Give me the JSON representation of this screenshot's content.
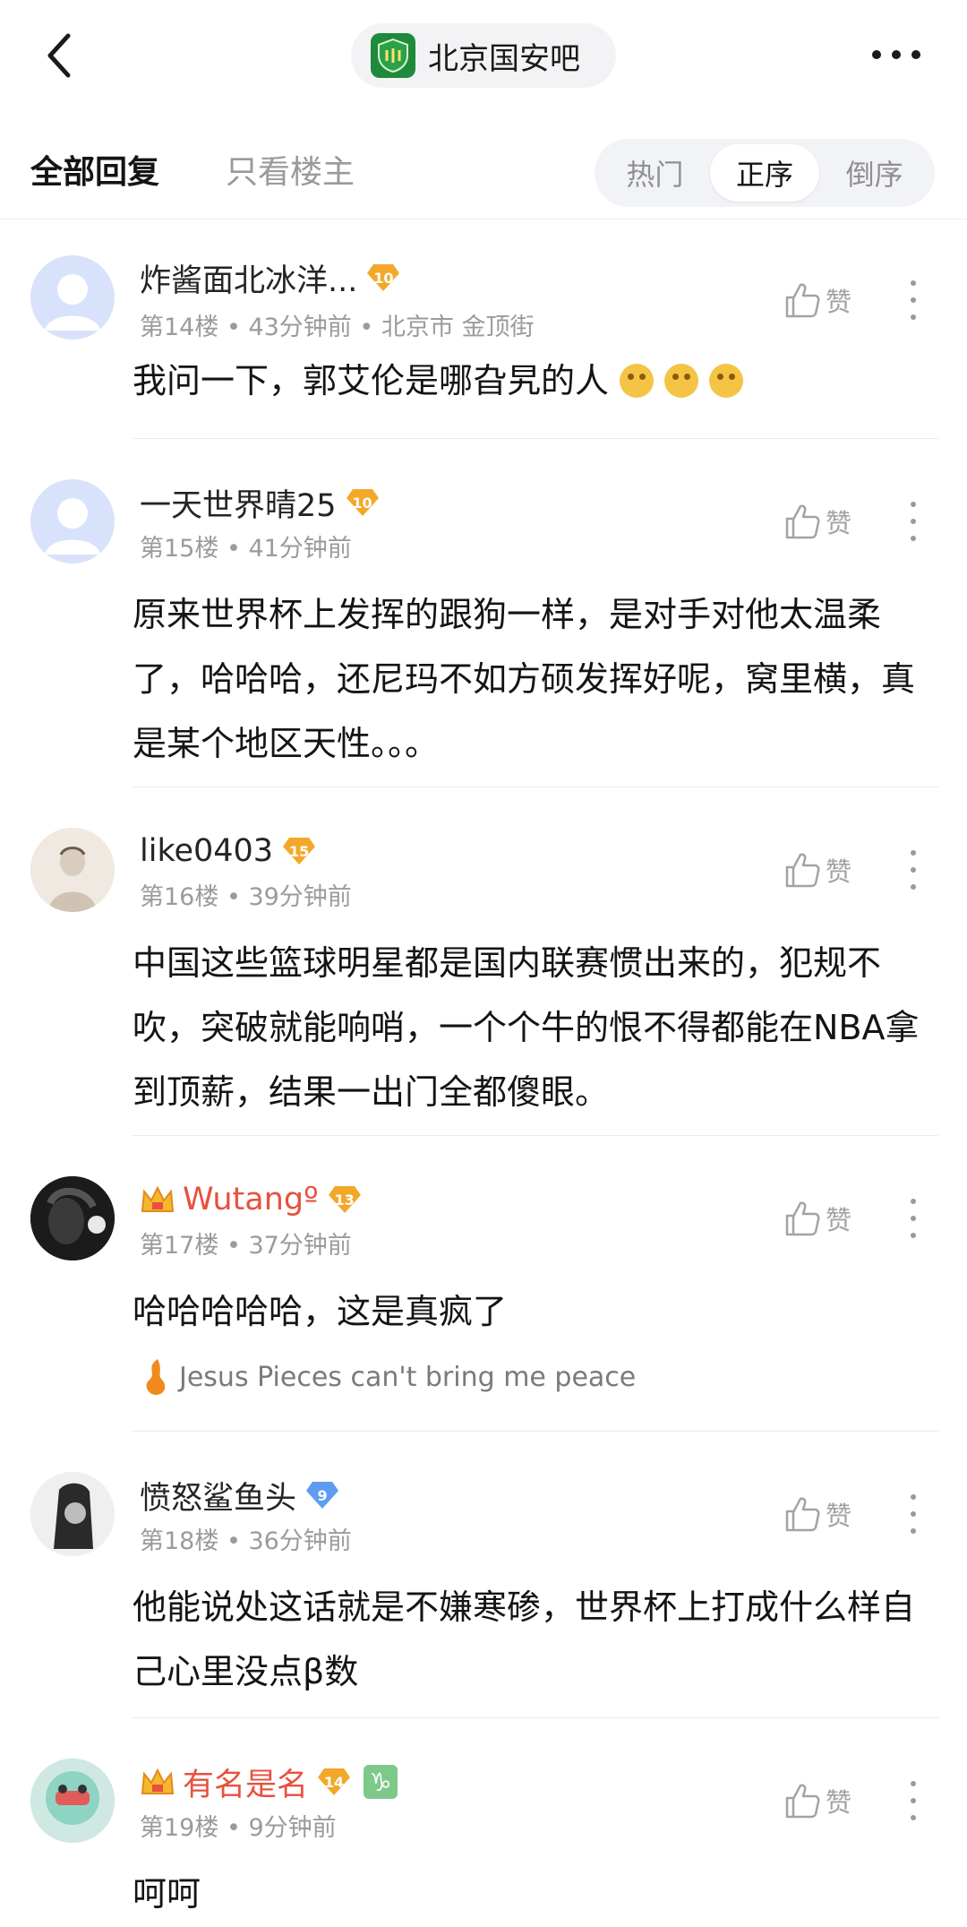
{
  "header": {
    "forum_name": "北京国安吧",
    "logo_color": "#1f8a3b"
  },
  "filters": {
    "all_replies": "全部回复",
    "op_only": "只看楼主",
    "sort": [
      "热门",
      "正序",
      "倒序"
    ],
    "active_sort": "正序"
  },
  "like_label": "赞",
  "comments": [
    {
      "username": "炸酱面北冰洋...",
      "level": "10",
      "floor": "第14楼",
      "time": "43分钟前",
      "location": "北京市 金顶街",
      "text": "我问一下，郭艾伦是哪旮旯的人",
      "emojis": 3
    },
    {
      "username": "一天世界晴25",
      "level": "10",
      "floor": "第15楼",
      "time": "41分钟前",
      "text": "原来世界杯上发挥的跟狗一样，是对手对他太温柔了，哈哈哈，还尼玛不如方硕发挥好呢，窝里横，真是某个地区天性。。。"
    },
    {
      "username": "like0403",
      "level": "15",
      "floor": "第16楼",
      "time": "39分钟前",
      "text": "中国这些篮球明星都是国内联赛惯出来的，犯规不吹，突破就能响哨，一个个牛的恨不得都能在NBA拿到顶薪，结果一出门全都傻眼。"
    },
    {
      "username": "Wutangº",
      "level": "13",
      "vip": true,
      "floor": "第17楼",
      "time": "37分钟前",
      "text": "哈哈哈哈哈，这是真疯了",
      "signature": "Jesus Pieces can't bring me peace"
    },
    {
      "username": "愤怒鲨鱼头",
      "level": "9",
      "floor": "第18楼",
      "time": "36分钟前",
      "text": "他能说处这话就是不嫌寒碜，世界杯上打成什么样自己心里没点β数"
    },
    {
      "username": "有名是名",
      "level": "14",
      "vip": true,
      "zodiac": "♑",
      "floor": "第19楼",
      "time": "9分钟前",
      "text": "呵呵"
    }
  ],
  "colors": {
    "vip_name": "#e8503f",
    "level_badge": "#f3a82a",
    "level_badge_blue": "#5e9cf2",
    "meta_gray": "#9b9b9b"
  }
}
